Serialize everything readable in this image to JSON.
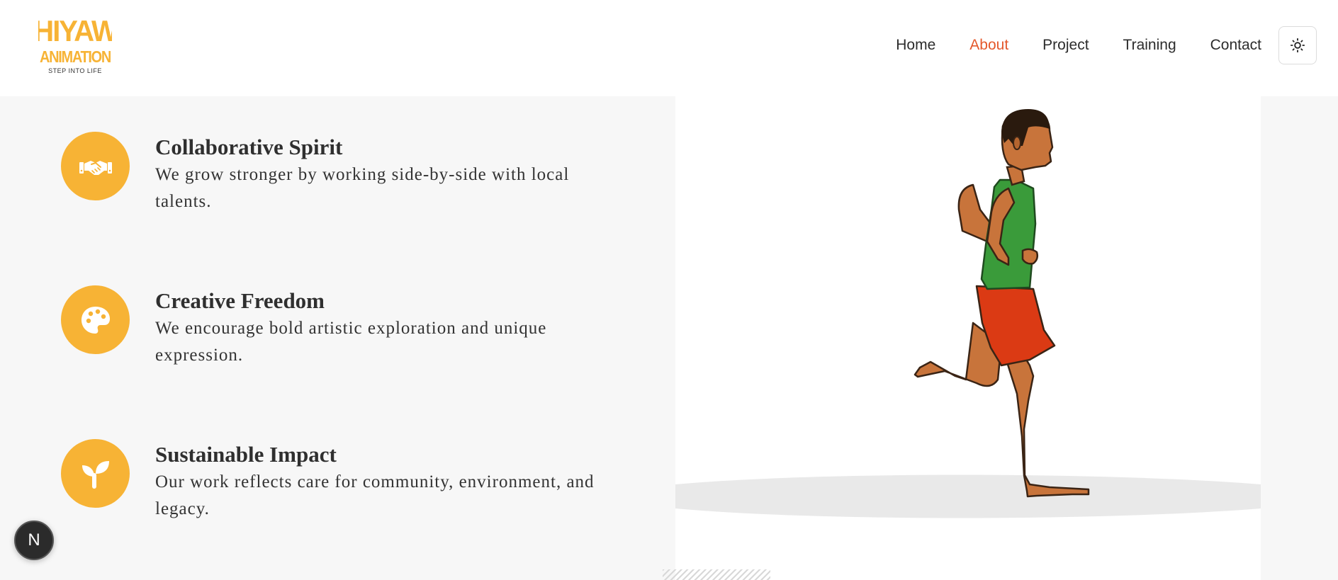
{
  "header": {
    "logo": {
      "line1": "HIYAW",
      "line2": "ANIMATION",
      "tagline": "STEP INTO LIFE",
      "color": "#f7b335"
    },
    "nav": [
      {
        "label": "Home",
        "active": false
      },
      {
        "label": "About",
        "active": true
      },
      {
        "label": "Project",
        "active": false
      },
      {
        "label": "Training",
        "active": false
      },
      {
        "label": "Contact",
        "active": false
      }
    ],
    "theme_toggle_icon": "sun-icon"
  },
  "features": [
    {
      "icon": "handshake-icon",
      "title": "Collaborative Spirit",
      "description": "We grow stronger by working side-by-side with local talents."
    },
    {
      "icon": "palette-icon",
      "title": "Creative Freedom",
      "description": "We encourage bold artistic exploration and unique expression."
    },
    {
      "icon": "sprout-icon",
      "title": "Sustainable Impact",
      "description": "Our work reflects care for community, environment, and legacy."
    }
  ],
  "colors": {
    "accent": "#f7b335",
    "nav_active": "#e4582b",
    "text": "#2f2f2f"
  },
  "illustration": "running-man-illustration",
  "dev_badge": {
    "label": "N"
  }
}
